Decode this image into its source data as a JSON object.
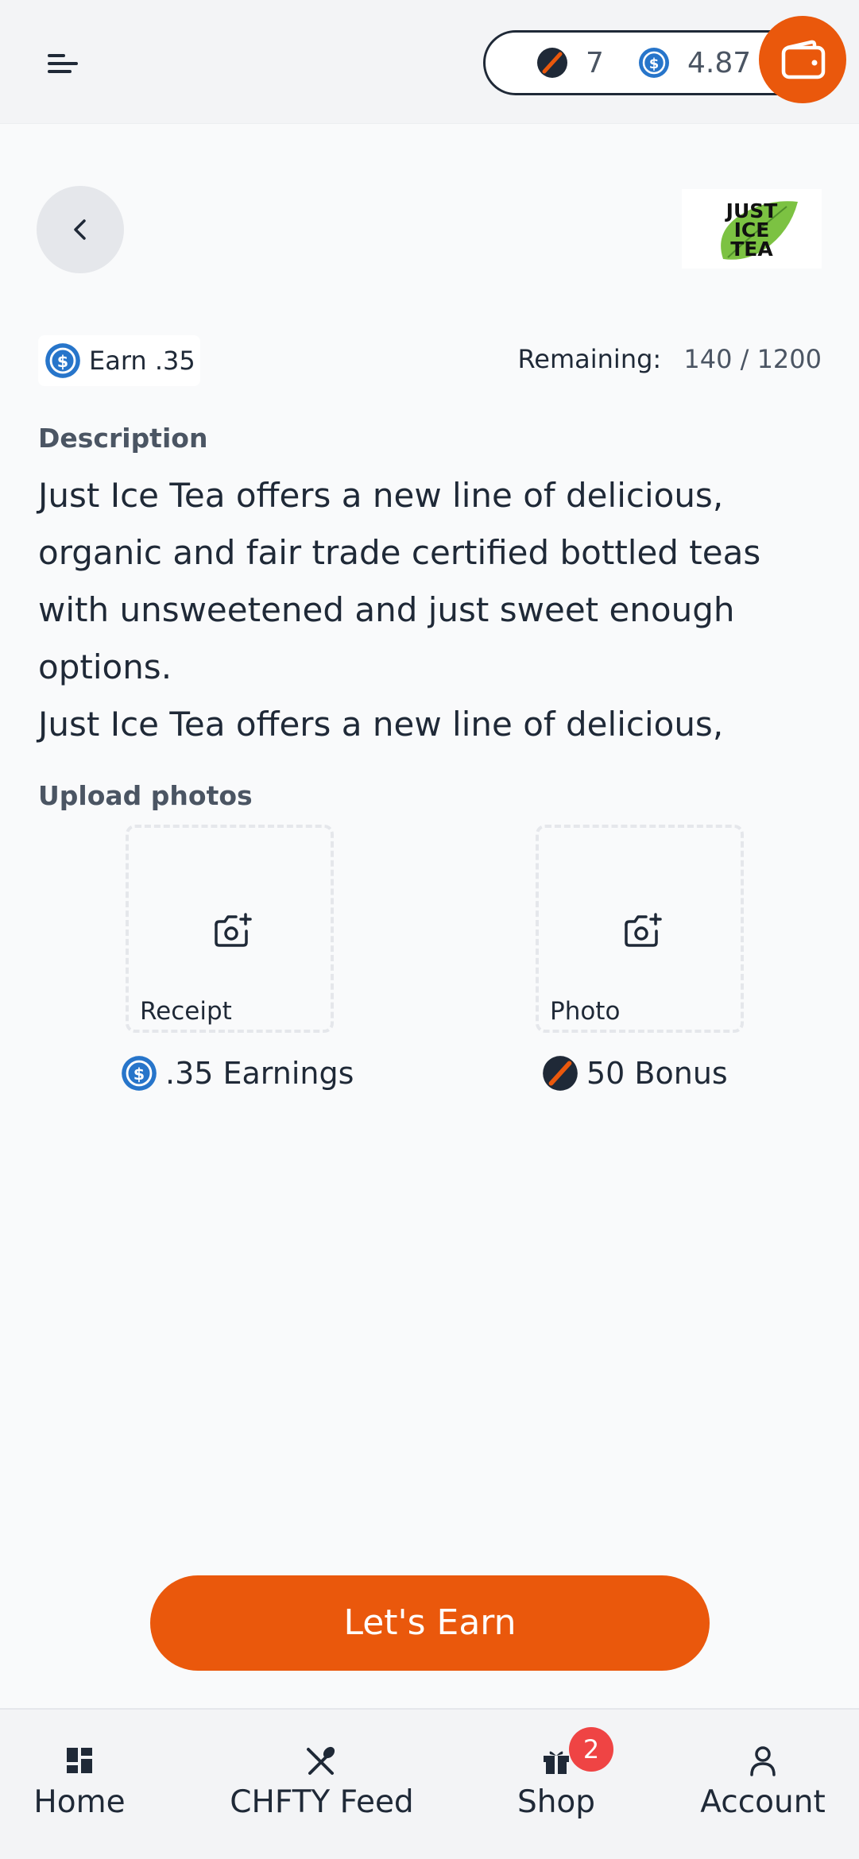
{
  "header": {
    "points_balance": "7",
    "usd_balance": "4.87"
  },
  "offer": {
    "earn_label": "Earn .35",
    "remaining_label": "Remaining:",
    "remaining_value": "140 / 1200",
    "description_title": "Description",
    "description_lines": [
      "Just Ice Tea offers a new line of delicious,",
      "organic and fair trade certified bottled teas",
      "with unsweetened and just sweet enough",
      "options.",
      "Just Ice Tea offers a new line of delicious,"
    ],
    "brand_logo_text": [
      "JUST",
      "ICE",
      "TEA"
    ]
  },
  "upload": {
    "title": "Upload photos",
    "receipt_label": "Receipt",
    "photo_label": "Photo",
    "receipt_reward": ".35 Earnings",
    "photo_reward": "50 Bonus"
  },
  "cta": {
    "label": "Let's Earn"
  },
  "nav": {
    "items": [
      {
        "label": "Home",
        "icon": "grid-icon"
      },
      {
        "label": "CHFTY Feed",
        "icon": "utensils-icon"
      },
      {
        "label": "Shop",
        "icon": "gift-icon"
      },
      {
        "label": "Account",
        "icon": "user-icon"
      }
    ],
    "shop_badge": "2"
  },
  "colors": {
    "accent": "#ea580c",
    "coin_blue": "#2775ca",
    "badge_red": "#ef4444",
    "background": "#f9fafb"
  }
}
